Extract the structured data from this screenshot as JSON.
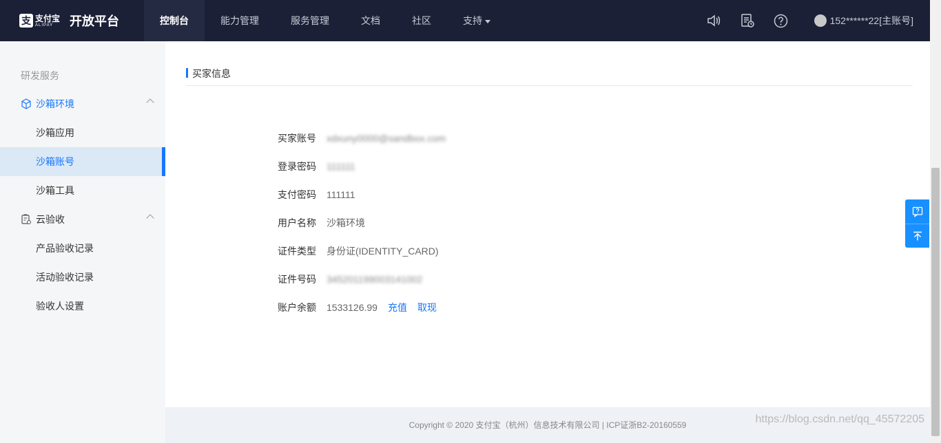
{
  "header": {
    "logo_cn": "支付宝",
    "logo_en": "ALIPAY",
    "platform": "开放平台",
    "nav": [
      {
        "label": "控制台",
        "active": true
      },
      {
        "label": "能力管理",
        "active": false
      },
      {
        "label": "服务管理",
        "active": false
      },
      {
        "label": "文档",
        "active": false
      },
      {
        "label": "社区",
        "active": false
      },
      {
        "label": "支持",
        "active": false
      }
    ],
    "user": "152******22[主账号]",
    "icons": [
      "speaker-icon",
      "document-clock-icon",
      "help-icon"
    ]
  },
  "sidebar": {
    "section": "研发服务",
    "groups": [
      {
        "label": "沙箱环境",
        "icon": "cube-icon",
        "items": [
          "沙箱应用",
          "沙箱账号",
          "沙箱工具"
        ]
      },
      {
        "label": "云验收",
        "icon": "clipboard-icon",
        "items": [
          "产品验收记录",
          "活动验收记录",
          "验收人设置"
        ]
      }
    ],
    "active_item": "沙箱账号"
  },
  "main": {
    "title": "买家信息",
    "rows": [
      {
        "label": "买家账号",
        "value": "xdxuny0000@sandbox.com"
      },
      {
        "label": "登录密码",
        "value": "111111"
      },
      {
        "label": "支付密码",
        "value": "111111"
      },
      {
        "label": "用户名称",
        "value": "沙箱环境"
      },
      {
        "label": "证件类型",
        "value": "身份证(IDENTITY_CARD)"
      },
      {
        "label": "证件号码",
        "value": "345201199003141002"
      },
      {
        "label": "账户余额",
        "value": "1533126.99",
        "links": [
          "充值",
          "取现"
        ]
      }
    ]
  },
  "footer": {
    "text": "Copyright © 2020 支付宝（杭州）信息技术有限公司   |   ICP证浙B2-20160559",
    "watermark": "https://blog.csdn.net/qq_45572205"
  },
  "colors": {
    "accent": "#1677ff",
    "topbar": "#1b2036"
  }
}
